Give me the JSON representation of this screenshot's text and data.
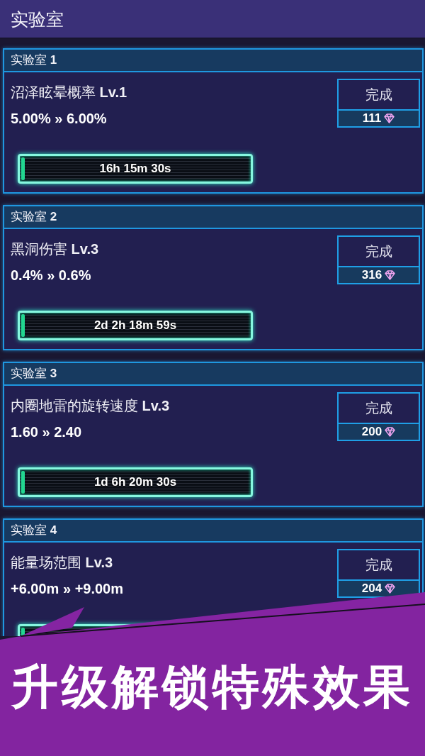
{
  "app_bar": {
    "title": "实验室"
  },
  "labs": [
    {
      "header": "实验室 **1**",
      "upgrade": "沼泽眩晕概率 **Lv.1**",
      "change": "5.00% » 6.00%",
      "button": {
        "label": "完成",
        "cost": "111"
      },
      "timer": {
        "level": 0.015,
        "time": "16h 15m 30s"
      }
    },
    {
      "header": "实验室 **2**",
      "upgrade": "黑洞伤害 **Lv.3**",
      "change": "0.4% » 0.6%",
      "button": {
        "label": "完成",
        "cost": "316"
      },
      "timer": {
        "level": 0.015,
        "time": "2d 2h 18m 59s"
      }
    },
    {
      "header": "实验室 **3**",
      "upgrade": "内圈地雷的旋转速度 **Lv.3**",
      "change": "1.60 » 2.40",
      "button": {
        "label": "完成",
        "cost": "200"
      },
      "timer": {
        "level": 0.015,
        "time": "1d 6h 20m 30s"
      }
    },
    {
      "header": "实验室 **4**",
      "upgrade": "能量场范围 **Lv.3**",
      "change": "+6.00m » +9.00m",
      "button": {
        "label": "完成",
        "cost": "204"
      },
      "timer": {
        "level": 0.015
      }
    }
  ],
  "banner": {
    "caption": "升级解锁特殊效果"
  }
}
